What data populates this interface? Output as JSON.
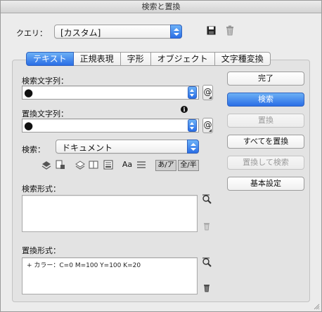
{
  "window": {
    "title": "検索と置換"
  },
  "query": {
    "label": "クエリ：",
    "value": "[カスタム]"
  },
  "tabs": [
    {
      "label": "テキスト",
      "active": true
    },
    {
      "label": "正規表現",
      "active": false
    },
    {
      "label": "字形",
      "active": false
    },
    {
      "label": "オブジェクト",
      "active": false
    },
    {
      "label": "文字種変換",
      "active": false
    }
  ],
  "find": {
    "label": "検索文字列：",
    "value": "●"
  },
  "change": {
    "label": "置換文字列：",
    "value": "●"
  },
  "search_scope": {
    "label": "検索：",
    "value": "ドキュメント"
  },
  "options": {
    "case_label": "Aa",
    "kana_label": "あ/ア",
    "width_label": "全/半"
  },
  "find_format": {
    "label": "検索形式：",
    "value": ""
  },
  "change_format": {
    "label": "置換形式：",
    "value": "+ カラー：C=0 M=100 Y=100 K=20"
  },
  "buttons": {
    "done": "完了",
    "find": "検索",
    "change": "置換",
    "change_all": "すべてを置換",
    "change_find": "置換して検索",
    "fewer_options": "基本設定"
  },
  "at_symbol": "@",
  "info_symbol": "i"
}
